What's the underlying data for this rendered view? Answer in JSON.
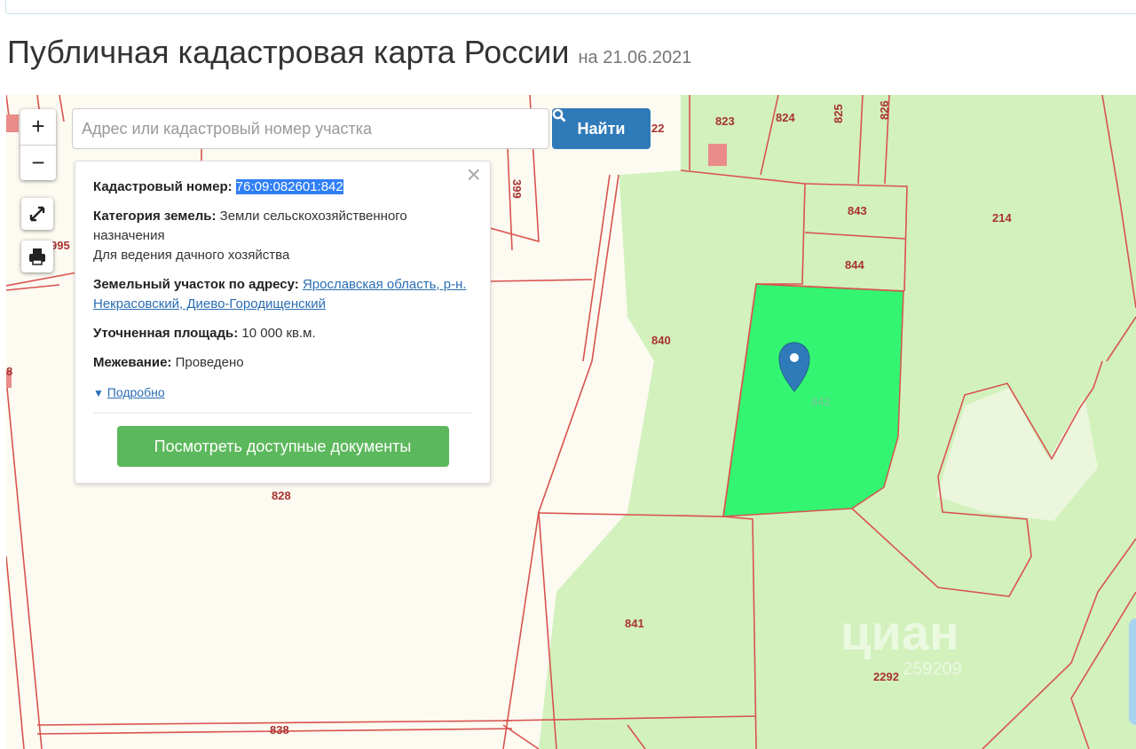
{
  "header": {
    "title": "Публичная кадастровая карта России",
    "date": "на 21.06.2021"
  },
  "search": {
    "placeholder": "Адрес или кадастровый номер участка",
    "button_label": "Найти"
  },
  "controls": {
    "zoom_in": "+",
    "zoom_out": "−"
  },
  "popup": {
    "cadastral_label": "Кадастровый номер:",
    "cadastral_value": "76:09:082601:842",
    "category_label": "Категория земель:",
    "category_value": "Земли сельскохозяйственного назначения",
    "category_use": "Для ведения дачного хозяйства",
    "address_label": "Земельный участок по адресу:",
    "address_value": "Ярославская область, р-н. Некрасовский, Диево-Городищенский",
    "area_label": "Уточненная площадь:",
    "area_value": "10 000 кв.м.",
    "survey_label": "Межевание:",
    "survey_value": "Проведено",
    "more_link": "Подробно",
    "docs_button": "Посмотреть доступные документы"
  },
  "map": {
    "parcel_labels": [
      "823",
      "824",
      "825",
      "826",
      "843",
      "844",
      "214",
      "840",
      "842",
      "828",
      "841",
      "2292",
      "838",
      "995",
      "399",
      "22",
      "8"
    ],
    "watermark": "циан",
    "watermark_id": "259209"
  },
  "colors": {
    "selected_parcel": "#33f571",
    "forest": "#d2f1bd",
    "boundary": "#d9534f",
    "search_button": "#2f7ab9",
    "docs_button": "#5cb85c",
    "marker": "#2f7ab9"
  }
}
